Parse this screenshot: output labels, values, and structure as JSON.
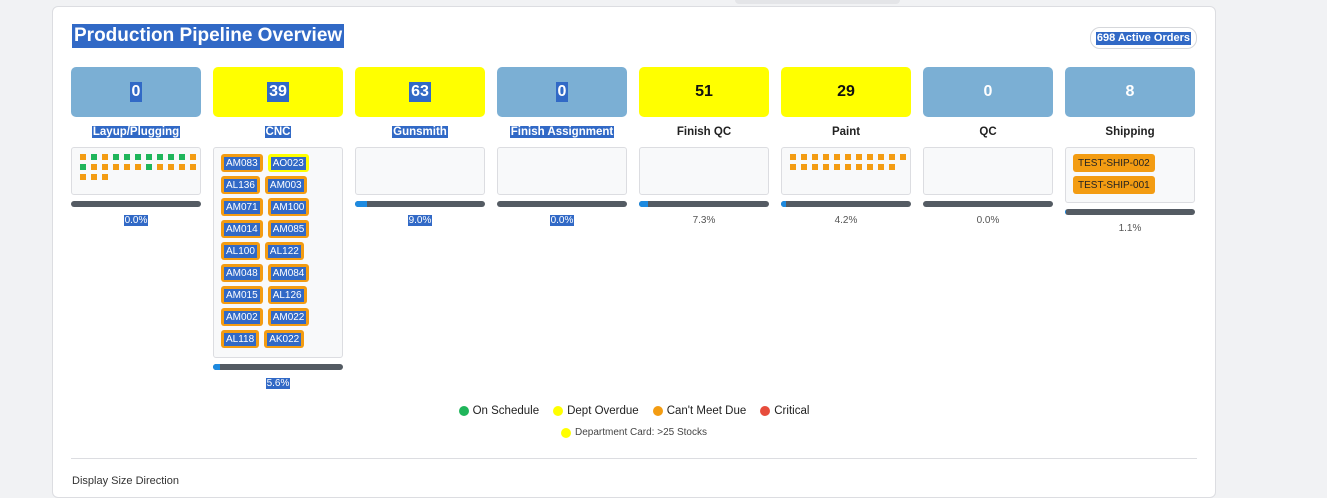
{
  "header": {
    "title": "Production Pipeline Overview",
    "active_orders": "698 Active Orders",
    "bottom_peek": "Display Size Direction"
  },
  "colors": {
    "blue_card": "#7bafd4",
    "yellow_card": "#ffff00",
    "on_schedule": "#1fb55a",
    "dept_overdue": "#ffff00",
    "cant_meet_due": "#f39c12",
    "critical": "#e74c3c",
    "progress_fill": "#1d8ae0",
    "progress_track": "#545b63"
  },
  "departments": [
    {
      "name": "Layup/Plugging",
      "count": "0",
      "color": "blue",
      "progress": 0.0,
      "pct": "0.0%",
      "dots": [
        "orange",
        "green",
        "orange",
        "green",
        "green",
        "green",
        "green",
        "green",
        "green",
        "green",
        "orange",
        "green",
        "orange",
        "orange",
        "orange",
        "orange",
        "orange",
        "green",
        "orange",
        "orange",
        "orange",
        "orange",
        "orange",
        "orange",
        "orange"
      ],
      "tags": []
    },
    {
      "name": "CNC",
      "count": "39",
      "color": "yellow",
      "progress": 5.6,
      "pct": "5.6%",
      "dots": [],
      "tags": [
        [
          "AM083",
          "AO023"
        ],
        [
          "AL136",
          "AM003"
        ],
        [
          "AM071",
          "AM100"
        ],
        [
          "AM014",
          "AM085"
        ],
        [
          "AL100",
          "AL122"
        ],
        [
          "AM048",
          "AM084"
        ],
        [
          "AM015",
          "AL126"
        ],
        [
          "AM002",
          "AM022"
        ],
        [
          "AL118",
          "AK022"
        ]
      ]
    },
    {
      "name": "Gunsmith",
      "count": "63",
      "color": "yellow",
      "progress": 9.0,
      "pct": "9.0%",
      "dots": [],
      "tags": []
    },
    {
      "name": "Finish Assignment",
      "count": "0",
      "color": "blue",
      "progress": 0.0,
      "pct": "0.0%",
      "dots": [],
      "tags": []
    },
    {
      "name": "Finish QC",
      "count": "51",
      "color": "yellow",
      "progress": 7.3,
      "pct": "7.3%",
      "dots": [],
      "tags": []
    },
    {
      "name": "Paint",
      "count": "29",
      "color": "yellow",
      "progress": 4.2,
      "pct": "4.2%",
      "dots": [
        "orange",
        "orange",
        "orange",
        "orange",
        "orange",
        "orange",
        "orange",
        "orange",
        "orange",
        "orange",
        "orange",
        "orange",
        "orange",
        "orange",
        "orange",
        "orange",
        "orange",
        "orange",
        "orange",
        "orange",
        "orange"
      ],
      "tags": []
    },
    {
      "name": "QC",
      "count": "0",
      "color": "blue",
      "progress": 0.0,
      "pct": "0.0%",
      "dots": [],
      "tags": []
    },
    {
      "name": "Shipping",
      "count": "8",
      "color": "blue",
      "progress": 1.1,
      "pct": "1.1%",
      "dots": [],
      "tags": [
        [
          "TEST-SHIP-002"
        ],
        [
          "TEST-SHIP-001"
        ]
      ]
    }
  ],
  "legend": [
    {
      "label": "On Schedule",
      "color": "#1fb55a"
    },
    {
      "label": "Dept Overdue",
      "color": "#ffff00"
    },
    {
      "label": "Can't Meet Due",
      "color": "#f39c12"
    },
    {
      "label": "Critical",
      "color": "#e74c3c"
    }
  ],
  "legend_note": "Department Card: >25 Stocks"
}
